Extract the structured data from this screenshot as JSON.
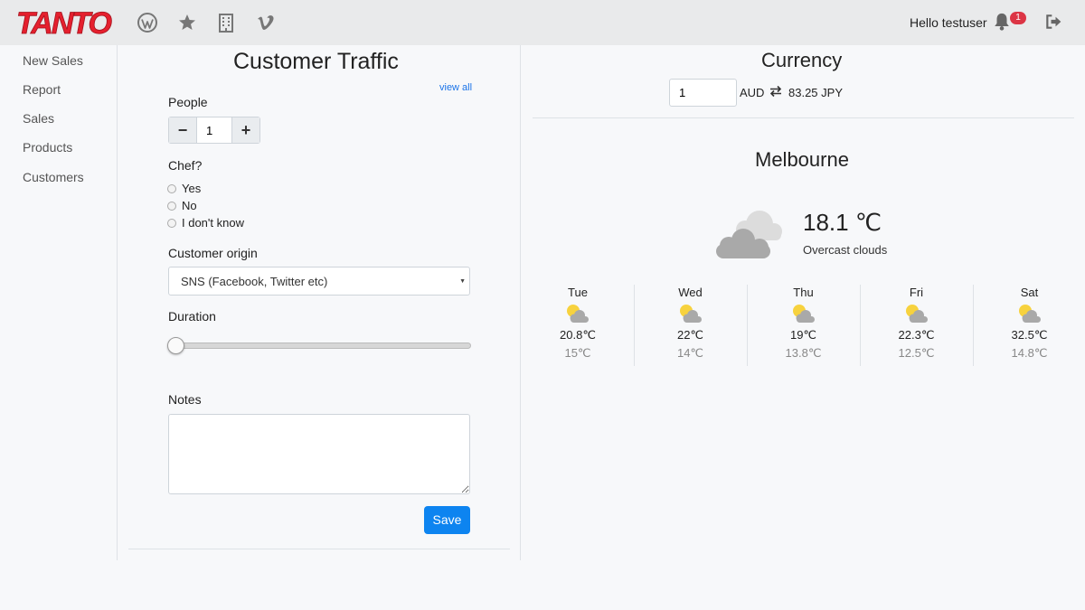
{
  "brand": {
    "logo_text": "TANTO",
    "logo_color": "#e5202e"
  },
  "header": {
    "nav_icons": [
      "wordpress-icon",
      "star-icon",
      "building-icon",
      "vimeo-icon"
    ],
    "greeting": "Hello testuser",
    "notification_count": "1",
    "badge_color": "#dc3545"
  },
  "sidebar": {
    "items": [
      {
        "label": "New Sales"
      },
      {
        "label": "Report"
      },
      {
        "label": "Sales"
      },
      {
        "label": "Products"
      },
      {
        "label": "Customers"
      }
    ]
  },
  "traffic": {
    "title": "Customer Traffic",
    "view_all": "view all",
    "people_label": "People",
    "people_value": "1",
    "minus": "−",
    "plus": "+",
    "chef_label": "Chef?",
    "chef_options": [
      "Yes",
      "No",
      "I don't know"
    ],
    "origin_label": "Customer origin",
    "origin_selected": "SNS (Facebook, Twitter etc)",
    "duration_label": "Duration",
    "duration_value": 0,
    "notes_label": "Notes",
    "notes_value": "",
    "save_label": "Save",
    "accent_color": "#0d84f0"
  },
  "currency": {
    "title": "Currency",
    "amount": "1",
    "from": "AUD",
    "result": "83.25 JPY"
  },
  "weather": {
    "city": "Melbourne",
    "current_temp": "18.1 ℃",
    "condition": "Overcast clouds",
    "icon": "overcast-cloud-icon",
    "forecast": [
      {
        "day": "Tue",
        "high": "20.8℃",
        "low": "15℃",
        "icon": "partly-cloudy-icon"
      },
      {
        "day": "Wed",
        "high": "22℃",
        "low": "14℃",
        "icon": "partly-cloudy-icon"
      },
      {
        "day": "Thu",
        "high": "19℃",
        "low": "13.8℃",
        "icon": "partly-cloudy-icon"
      },
      {
        "day": "Fri",
        "high": "22.3℃",
        "low": "12.5℃",
        "icon": "partly-cloudy-icon"
      },
      {
        "day": "Sat",
        "high": "32.5℃",
        "low": "14.8℃",
        "icon": "partly-cloudy-icon"
      }
    ]
  }
}
